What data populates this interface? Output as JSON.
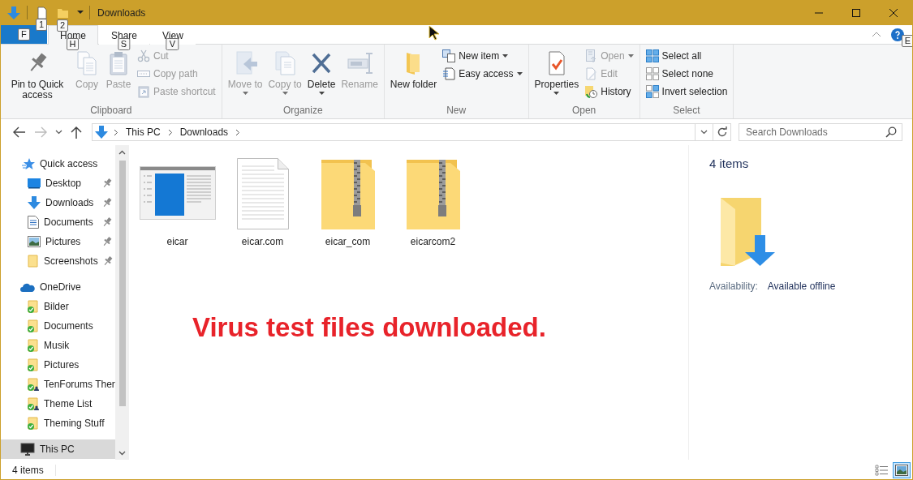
{
  "window": {
    "title": "Downloads",
    "keytips": [
      "1",
      "2"
    ]
  },
  "ribbon": {
    "file_keytip": "F",
    "tabs": [
      {
        "label": "Home",
        "keytip": "H",
        "selected": true
      },
      {
        "label": "Share",
        "keytip": "S",
        "selected": false
      },
      {
        "label": "View",
        "keytip": "V",
        "selected": false
      }
    ],
    "help_keytip": "E",
    "groups": [
      {
        "name": "Clipboard",
        "items": [
          {
            "kind": "large",
            "label": "Pin to Quick access",
            "dropdown": false,
            "disabled": false
          },
          {
            "kind": "large",
            "label": "Copy",
            "dropdown": false,
            "disabled": true
          },
          {
            "kind": "large",
            "label": "Paste",
            "dropdown": false,
            "disabled": true
          },
          {
            "kind": "stack",
            "items": [
              {
                "label": "Cut",
                "dropdown": false,
                "disabled": true
              },
              {
                "label": "Copy path",
                "dropdown": false,
                "disabled": true
              },
              {
                "label": "Paste shortcut",
                "dropdown": false,
                "disabled": true
              }
            ]
          }
        ]
      },
      {
        "name": "Organize",
        "items": [
          {
            "kind": "large",
            "label": "Move to",
            "dropdown": true,
            "disabled": true
          },
          {
            "kind": "large",
            "label": "Copy to",
            "dropdown": true,
            "disabled": true
          },
          {
            "kind": "large",
            "label": "Delete",
            "dropdown": true,
            "disabled": false
          },
          {
            "kind": "large",
            "label": "Rename",
            "dropdown": false,
            "disabled": true
          }
        ]
      },
      {
        "name": "New",
        "items": [
          {
            "kind": "large",
            "label": "New folder",
            "dropdown": false,
            "disabled": false
          },
          {
            "kind": "stack",
            "items": [
              {
                "label": "New item",
                "dropdown": true,
                "disabled": false
              },
              {
                "label": "Easy access",
                "dropdown": true,
                "disabled": false
              }
            ]
          }
        ]
      },
      {
        "name": "Open",
        "items": [
          {
            "kind": "large",
            "label": "Properties",
            "dropdown": true,
            "disabled": false
          },
          {
            "kind": "stack",
            "items": [
              {
                "label": "Open",
                "dropdown": true,
                "disabled": true
              },
              {
                "label": "Edit",
                "dropdown": false,
                "disabled": true
              },
              {
                "label": "History",
                "dropdown": false,
                "disabled": false
              }
            ]
          }
        ]
      },
      {
        "name": "Select",
        "items": [
          {
            "kind": "stack",
            "items": [
              {
                "label": "Select all",
                "dropdown": false,
                "disabled": false
              },
              {
                "label": "Select none",
                "dropdown": false,
                "disabled": false
              },
              {
                "label": "Invert selection",
                "dropdown": false,
                "disabled": false
              }
            ]
          }
        ]
      }
    ]
  },
  "address": {
    "crumbs": [
      "This PC",
      "Downloads"
    ],
    "search_placeholder": "Search Downloads"
  },
  "navigation": [
    {
      "label": "Quick access",
      "selected": false,
      "children": [
        {
          "label": "Desktop",
          "pinned": true,
          "selected": false
        },
        {
          "label": "Downloads",
          "pinned": true,
          "selected": false
        },
        {
          "label": "Documents",
          "pinned": true,
          "selected": false
        },
        {
          "label": "Pictures",
          "pinned": true,
          "selected": false
        },
        {
          "label": "Screenshots",
          "pinned": true,
          "selected": false
        }
      ]
    },
    {
      "label": "OneDrive",
      "selected": false,
      "children": [
        {
          "label": "Bilder",
          "synced": true,
          "shared": false,
          "selected": false
        },
        {
          "label": "Documents",
          "synced": true,
          "shared": false,
          "selected": false
        },
        {
          "label": "Musik",
          "synced": true,
          "shared": false,
          "selected": false
        },
        {
          "label": "Pictures",
          "synced": true,
          "shared": false,
          "selected": false
        },
        {
          "label": "TenForums Ther",
          "synced": true,
          "shared": true,
          "selected": false
        },
        {
          "label": "Theme List",
          "synced": true,
          "shared": true,
          "selected": false
        },
        {
          "label": "Theming Stuff",
          "synced": true,
          "shared": false,
          "selected": false
        }
      ]
    },
    {
      "label": "This PC",
      "selected": true
    }
  ],
  "files": [
    {
      "name": "eicar",
      "kind": "app"
    },
    {
      "name": "eicar.com",
      "kind": "document"
    },
    {
      "name": "eicar_com",
      "kind": "zip"
    },
    {
      "name": "eicarcom2",
      "kind": "zip"
    }
  ],
  "annotation": "Virus test files downloaded.",
  "details": {
    "heading": "4 items",
    "availability_label": "Availability:",
    "availability_value": "Available offline"
  },
  "status_bar": {
    "count": "4 items",
    "views": [
      {
        "selected": false
      },
      {
        "selected": true
      }
    ]
  }
}
